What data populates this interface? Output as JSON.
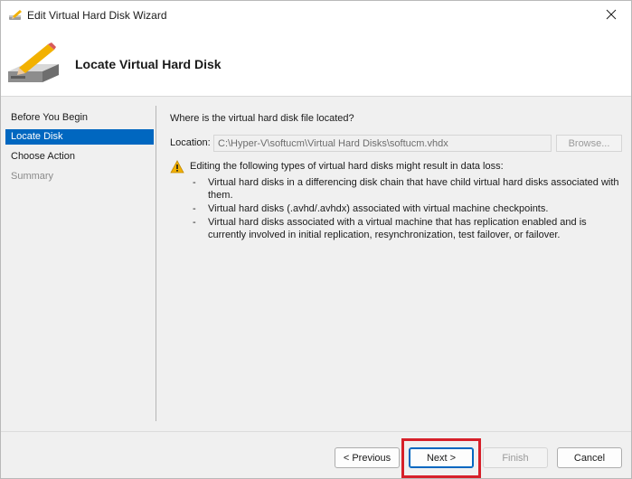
{
  "window": {
    "title": "Edit Virtual Hard Disk Wizard"
  },
  "header": {
    "title": "Locate Virtual Hard Disk"
  },
  "sidebar": {
    "items": [
      {
        "label": "Before You Begin",
        "state": "normal"
      },
      {
        "label": "Locate Disk",
        "state": "selected"
      },
      {
        "label": "Choose Action",
        "state": "normal"
      },
      {
        "label": "Summary",
        "state": "disabled"
      }
    ]
  },
  "main": {
    "question": "Where is the virtual hard disk file located?",
    "location_label": "Location:",
    "location_value": "C:\\Hyper-V\\softucm\\Virtual Hard Disks\\softucm.vhdx",
    "browse_label": "Browse...",
    "warning_text": "Editing the following types of virtual hard disks might result in data loss:",
    "bullet_dash": "-",
    "bullets": [
      "Virtual hard disks in a differencing disk chain that have child virtual hard disks associated with them.",
      "Virtual hard disks (.avhd/.avhdx) associated with virtual machine checkpoints.",
      "Virtual hard disks associated with a virtual machine that has replication enabled and is currently involved in initial replication, resynchronization, test failover, or failover."
    ]
  },
  "footer": {
    "previous_label": "< Previous",
    "next_label": "Next >",
    "finish_label": "Finish",
    "cancel_label": "Cancel"
  },
  "icons": {
    "app": "wizard-disk-pencil-icon",
    "close": "close-icon",
    "hero": "hard-disk-pencil-icon",
    "warning": "warning-icon"
  },
  "colors": {
    "accent": "#0067c0",
    "highlight": "#d6202a",
    "warning": "#f2b100"
  }
}
